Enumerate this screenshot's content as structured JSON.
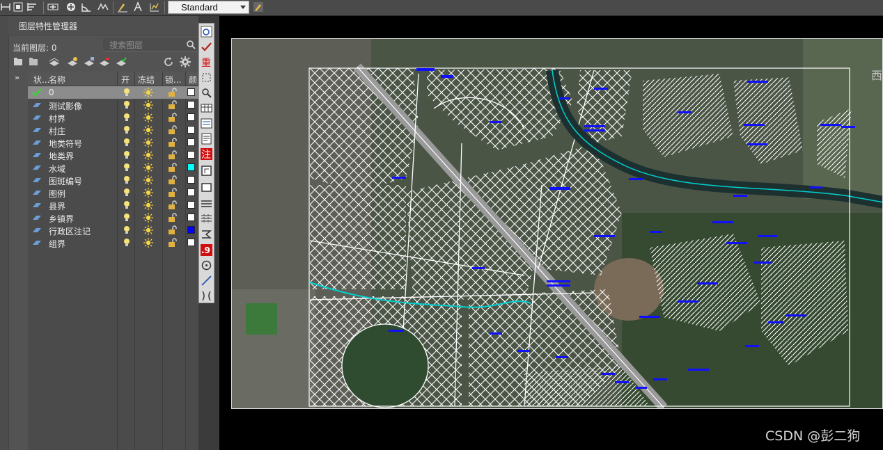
{
  "toolbar": {
    "text_style": "Standard",
    "icons": [
      "dimension-linear-icon",
      "dimension-aligned-icon",
      "dimension-baseline-icon",
      "dimension-center-icon",
      "dimension-continue-icon",
      "dimension-angular-icon",
      "dimension-edit-icon",
      "dimension-text-icon",
      "dimension-tolerance-icon",
      "dimension-update-icon"
    ]
  },
  "layer_panel": {
    "title": "图层特性管理器",
    "current_layer_label": "当前图层: 0",
    "search_placeholder": "搜索图层",
    "columns": {
      "status": "状...",
      "name": "名称",
      "on": "开",
      "freeze": "冻结",
      "lock": "锁...",
      "color": "颜"
    },
    "layers": [
      {
        "name": "0",
        "color": "#ffffff",
        "current": true
      },
      {
        "name": "测试影像",
        "color": "#ffffff",
        "current": false
      },
      {
        "name": "村界",
        "color": "#ffffff",
        "current": false
      },
      {
        "name": "村庄",
        "color": "#ffffff",
        "current": false
      },
      {
        "name": "地类符号",
        "color": "#ffffff",
        "current": false
      },
      {
        "name": "地类界",
        "color": "#ffffff",
        "current": false
      },
      {
        "name": "水域",
        "color": "#00ffff",
        "current": false
      },
      {
        "name": "图斑编号",
        "color": "#ffffff",
        "current": false
      },
      {
        "name": "图例",
        "color": "#ffffff",
        "current": false
      },
      {
        "name": "县界",
        "color": "#ffffff",
        "current": false
      },
      {
        "name": "乡镇界",
        "color": "#ffffff",
        "current": false
      },
      {
        "name": "行政区注记",
        "color": "#0000ff",
        "current": false
      },
      {
        "name": "组界",
        "color": "#ffffff",
        "current": false
      }
    ]
  },
  "vertical_toolbar": {
    "tool1_label": "重",
    "tool2_label": "注",
    "tool3_label": ".9"
  },
  "map": {
    "edge_label": "西"
  },
  "watermark": "CSDN @彭二狗"
}
